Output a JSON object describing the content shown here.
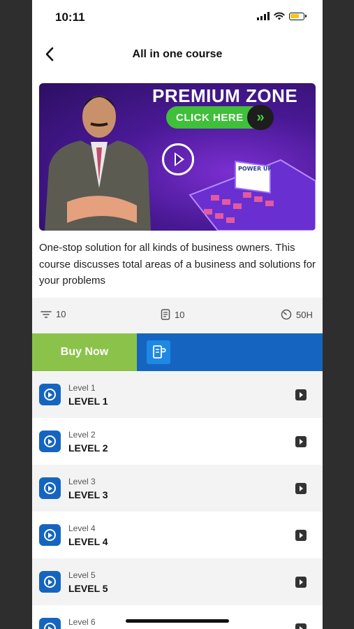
{
  "status_bar": {
    "time": "10:11"
  },
  "header": {
    "title": "All in one course"
  },
  "banner": {
    "headline": "PREMIUM ZONE",
    "cta_label": "CLICK HERE",
    "cta_arrows": "»",
    "sign_text": "POWER UP"
  },
  "description": "One-stop solution for all kinds of business owners. This course discusses total areas of a business and solutions for your problems",
  "stats": {
    "lessons": "10",
    "documents": "10",
    "duration": "50H"
  },
  "actions": {
    "buy_now": "Buy Now"
  },
  "levels": [
    {
      "sub": "Level 1",
      "name": "LEVEL 1"
    },
    {
      "sub": "Level 2",
      "name": "LEVEL 2"
    },
    {
      "sub": "Level 3",
      "name": "LEVEL 3"
    },
    {
      "sub": "Level 4",
      "name": "LEVEL 4"
    },
    {
      "sub": "Level 5",
      "name": "LEVEL 5"
    },
    {
      "sub": "Level 6",
      "name": ""
    }
  ],
  "colors": {
    "buy_now": "#8bc34a",
    "primary_blue": "#1565c0",
    "banner_purple": "#4a1996",
    "cta_green": "#3fbf3a"
  }
}
